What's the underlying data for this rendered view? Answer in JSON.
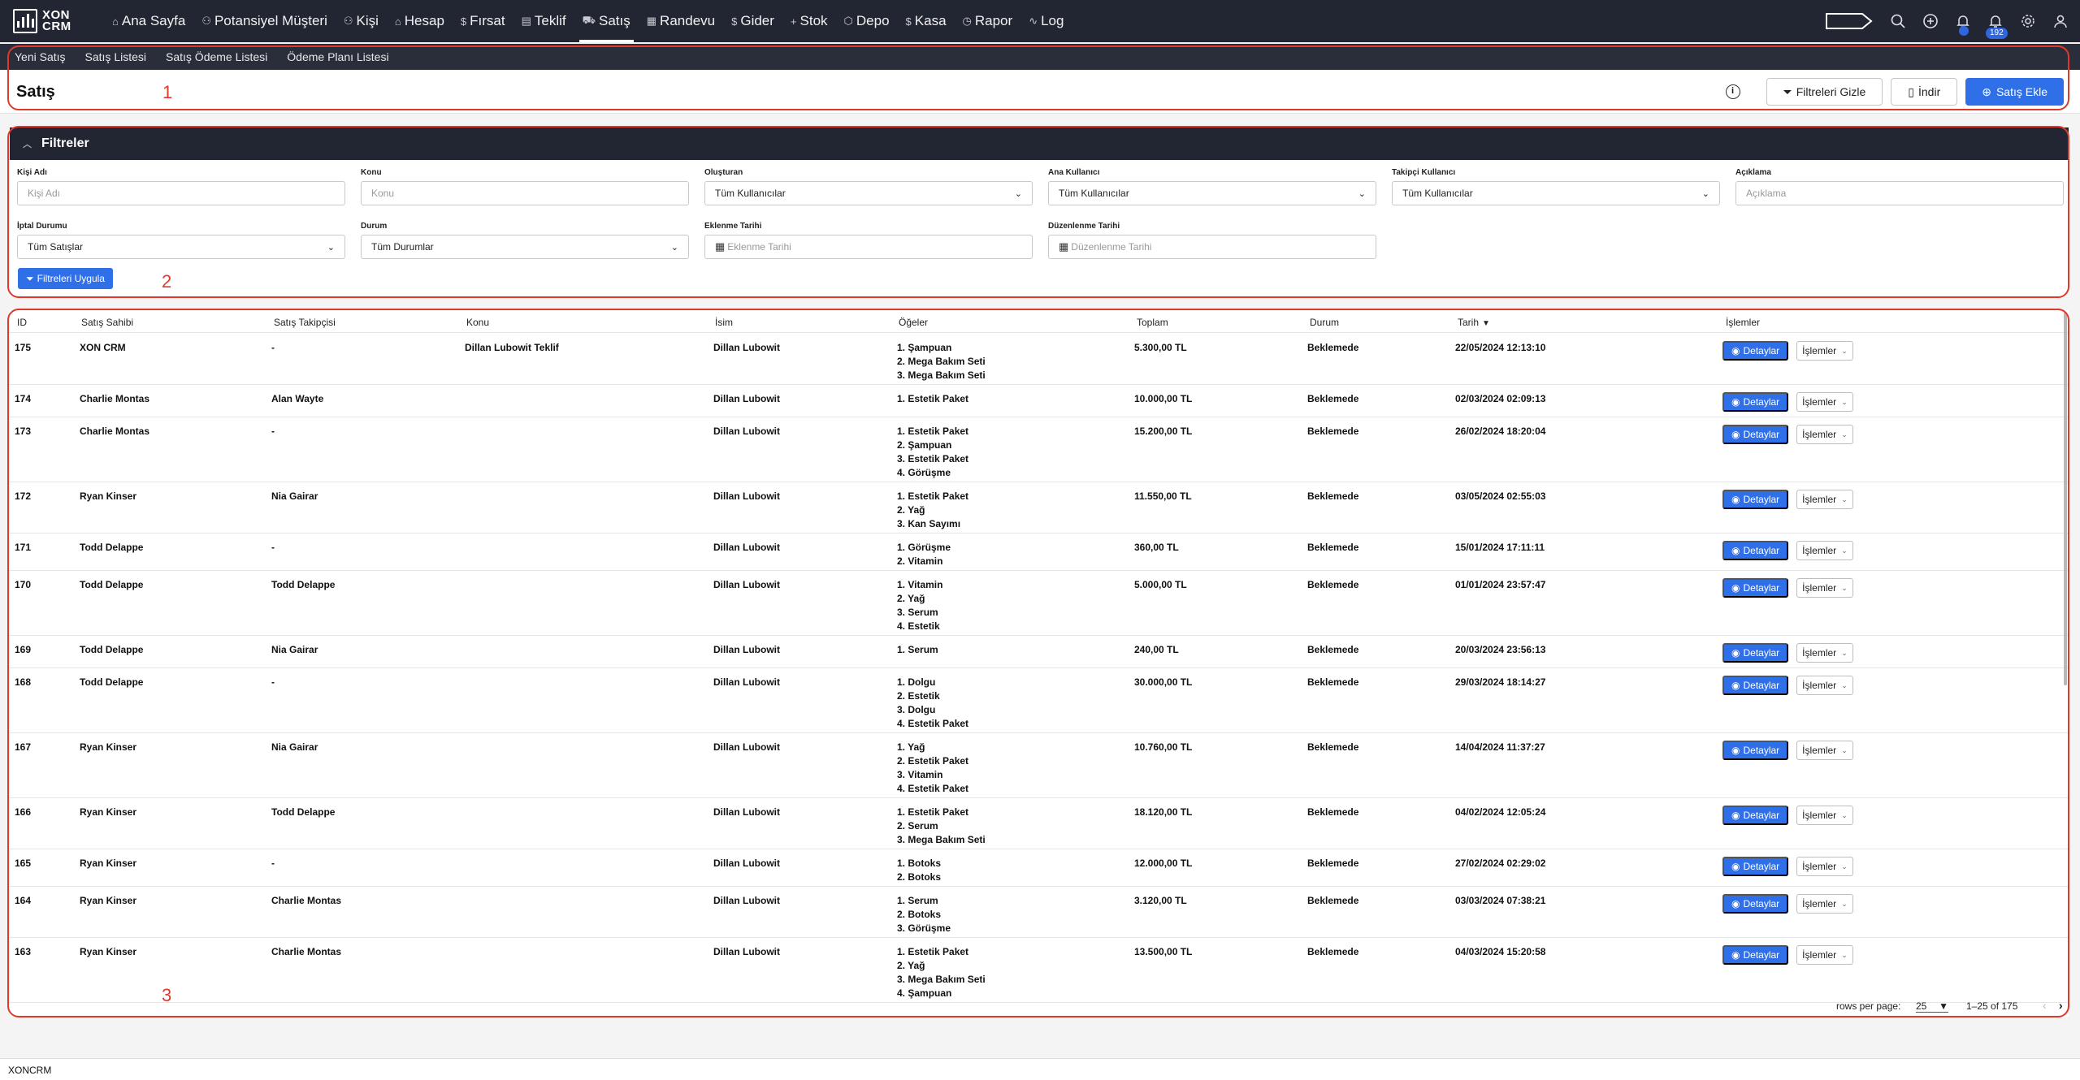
{
  "app": {
    "logo_line1": "XON",
    "logo_line2": "CRM",
    "footer": "XONCRM"
  },
  "nav": {
    "items": [
      {
        "icon": "⌂",
        "label": "Ana Sayfa"
      },
      {
        "icon": "⚇",
        "label": "Potansiyel Müşteri"
      },
      {
        "icon": "⚇",
        "label": "Kişi"
      },
      {
        "icon": "⌂",
        "label": "Hesap"
      },
      {
        "icon": "$",
        "label": "Fırsat"
      },
      {
        "icon": "▤",
        "label": "Teklif"
      },
      {
        "icon": "⛟",
        "label": "Satış"
      },
      {
        "icon": "▦",
        "label": "Randevu"
      },
      {
        "icon": "$",
        "label": "Gider"
      },
      {
        "icon": "+",
        "label": "Stok"
      },
      {
        "icon": "⬡",
        "label": "Depo"
      },
      {
        "icon": "$",
        "label": "Kasa"
      },
      {
        "icon": "◷",
        "label": "Rapor"
      },
      {
        "icon": "∿",
        "label": "Log"
      }
    ],
    "active": "Satış",
    "notification_count": "192"
  },
  "subnav": {
    "items": [
      "Yeni Satış",
      "Satış Listesi",
      "Satış Ödeme Listesi",
      "Ödeme Planı Listesi"
    ]
  },
  "header": {
    "title": "Satış",
    "hide_filters": "Filtreleri Gizle",
    "download": "İndir",
    "add_sale": "Satış Ekle"
  },
  "filters": {
    "title": "Filtreler",
    "fields": [
      {
        "label": "Kişi Adı",
        "placeholder": "Kişi Adı",
        "type": "input"
      },
      {
        "label": "Konu",
        "placeholder": "Konu",
        "type": "input"
      },
      {
        "label": "Oluşturan",
        "value": "Tüm Kullanıcılar",
        "type": "select"
      },
      {
        "label": "Ana Kullanıcı",
        "value": "Tüm Kullanıcılar",
        "type": "select"
      },
      {
        "label": "Takipçi Kullanıcı",
        "value": "Tüm Kullanıcılar",
        "type": "select"
      },
      {
        "label": "Açıklama",
        "placeholder": "Açıklama",
        "type": "input"
      },
      {
        "label": "İptal Durumu",
        "value": "Tüm Satışlar",
        "type": "select"
      },
      {
        "label": "Durum",
        "value": "Tüm Durumlar",
        "type": "select"
      },
      {
        "label": "Eklenme Tarihi",
        "placeholder": "Eklenme Tarihi",
        "type": "date"
      },
      {
        "label": "Düzenlenme Tarihi",
        "placeholder": "Düzenlenme Tarihi",
        "type": "date"
      }
    ],
    "apply": "Filtreleri Uygula"
  },
  "table": {
    "columns": [
      "ID",
      "Satış Sahibi",
      "Satış Takipçisi",
      "Konu",
      "İsim",
      "Öğeler",
      "Toplam",
      "Durum",
      "Tarih",
      "İşlemler"
    ],
    "sort_indicator": "▼",
    "detail_label": "Detaylar",
    "actions_label": "İşlemler",
    "rows": [
      {
        "id": "175",
        "owner": "XON CRM",
        "follower": "-",
        "subject": "Dillan Lubowit Teklif",
        "name": "Dillan Lubowit",
        "items": [
          "1. Şampuan",
          "2. Mega Bakım Seti",
          "3. Mega Bakım Seti"
        ],
        "total": "5.300,00 TL",
        "status": "Beklemede",
        "date": "22/05/2024 12:13:10"
      },
      {
        "id": "174",
        "owner": "Charlie Montas",
        "follower": "Alan Wayte",
        "subject": "",
        "name": "Dillan Lubowit",
        "items": [
          "1. Estetik Paket"
        ],
        "total": "10.000,00 TL",
        "status": "Beklemede",
        "date": "02/03/2024 02:09:13"
      },
      {
        "id": "173",
        "owner": "Charlie Montas",
        "follower": "-",
        "subject": "",
        "name": "Dillan Lubowit",
        "items": [
          "1. Estetik Paket",
          "2. Şampuan",
          "3. Estetik Paket",
          "4. Görüşme"
        ],
        "total": "15.200,00 TL",
        "status": "Beklemede",
        "date": "26/02/2024 18:20:04"
      },
      {
        "id": "172",
        "owner": "Ryan Kinser",
        "follower": "Nia Gairar",
        "subject": "",
        "name": "Dillan Lubowit",
        "items": [
          "1. Estetik Paket",
          "2. Yağ",
          "3. Kan Sayımı"
        ],
        "total": "11.550,00 TL",
        "status": "Beklemede",
        "date": "03/05/2024 02:55:03"
      },
      {
        "id": "171",
        "owner": "Todd Delappe",
        "follower": "-",
        "subject": "",
        "name": "Dillan Lubowit",
        "items": [
          "1. Görüşme",
          "2. Vitamin"
        ],
        "total": "360,00 TL",
        "status": "Beklemede",
        "date": "15/01/2024 17:11:11"
      },
      {
        "id": "170",
        "owner": "Todd Delappe",
        "follower": "Todd Delappe",
        "subject": "",
        "name": "Dillan Lubowit",
        "items": [
          "1. Vitamin",
          "2. Yağ",
          "3. Serum",
          "4. Estetik"
        ],
        "total": "5.000,00 TL",
        "status": "Beklemede",
        "date": "01/01/2024 23:57:47"
      },
      {
        "id": "169",
        "owner": "Todd Delappe",
        "follower": "Nia Gairar",
        "subject": "",
        "name": "Dillan Lubowit",
        "items": [
          "1. Serum"
        ],
        "total": "240,00 TL",
        "status": "Beklemede",
        "date": "20/03/2024 23:56:13"
      },
      {
        "id": "168",
        "owner": "Todd Delappe",
        "follower": "-",
        "subject": "",
        "name": "Dillan Lubowit",
        "items": [
          "1. Dolgu",
          "2. Estetik",
          "3. Dolgu",
          "4. Estetik Paket"
        ],
        "total": "30.000,00 TL",
        "status": "Beklemede",
        "date": "29/03/2024 18:14:27"
      },
      {
        "id": "167",
        "owner": "Ryan Kinser",
        "follower": "Nia Gairar",
        "subject": "",
        "name": "Dillan Lubowit",
        "items": [
          "1. Yağ",
          "2. Estetik Paket",
          "3. Vitamin",
          "4. Estetik Paket"
        ],
        "total": "10.760,00 TL",
        "status": "Beklemede",
        "date": "14/04/2024 11:37:27"
      },
      {
        "id": "166",
        "owner": "Ryan Kinser",
        "follower": "Todd Delappe",
        "subject": "",
        "name": "Dillan Lubowit",
        "items": [
          "1. Estetik Paket",
          "2. Serum",
          "3. Mega Bakım Seti"
        ],
        "total": "18.120,00 TL",
        "status": "Beklemede",
        "date": "04/02/2024 12:05:24"
      },
      {
        "id": "165",
        "owner": "Ryan Kinser",
        "follower": "-",
        "subject": "",
        "name": "Dillan Lubowit",
        "items": [
          "1. Botoks",
          "2. Botoks"
        ],
        "total": "12.000,00 TL",
        "status": "Beklemede",
        "date": "27/02/2024 02:29:02"
      },
      {
        "id": "164",
        "owner": "Ryan Kinser",
        "follower": "Charlie Montas",
        "subject": "",
        "name": "Dillan Lubowit",
        "items": [
          "1. Serum",
          "2. Botoks",
          "3. Görüşme"
        ],
        "total": "3.120,00 TL",
        "status": "Beklemede",
        "date": "03/03/2024 07:38:21"
      },
      {
        "id": "163",
        "owner": "Ryan Kinser",
        "follower": "Charlie Montas",
        "subject": "",
        "name": "Dillan Lubowit",
        "items": [
          "1. Estetik Paket",
          "2. Yağ",
          "3. Mega Bakım Seti",
          "4. Şampuan"
        ],
        "total": "13.500,00 TL",
        "status": "Beklemede",
        "date": "04/03/2024 15:20:58"
      }
    ]
  },
  "pagination": {
    "rows_per_page_label": "rows per page:",
    "rows_per_page": "25",
    "range": "1–25 of 175"
  },
  "annotations": [
    "1",
    "2",
    "3"
  ],
  "colors": {
    "nav_bg": "#222633",
    "accent": "#2f6fe8",
    "annotation": "#e0392b"
  }
}
